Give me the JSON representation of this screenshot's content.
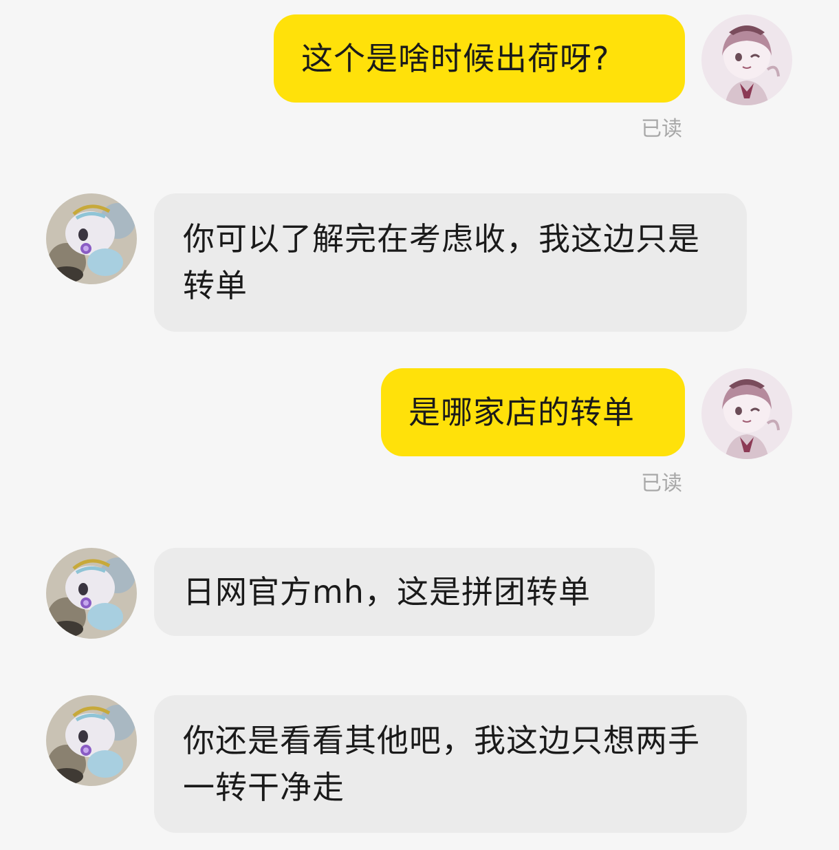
{
  "chat": {
    "messages": [
      {
        "side": "out",
        "text": "这个是啥时候出荷呀?",
        "status": "已读",
        "avatar": "self-avatar"
      },
      {
        "side": "in",
        "text": "你可以了解完在考虑收，我这边只是转单",
        "avatar": "seller-avatar"
      },
      {
        "side": "out",
        "text": "是哪家店的转单",
        "status": "已读",
        "avatar": "self-avatar"
      },
      {
        "side": "in",
        "text": "日网官方mh，这是拼团转单",
        "avatar": "seller-avatar"
      },
      {
        "side": "in",
        "text": "你还是看看其他吧，我这边只想两手一转干净走",
        "avatar": "seller-avatar"
      }
    ]
  },
  "colors": {
    "outgoing_bubble": "#ffe10a",
    "incoming_bubble": "#ebebeb",
    "background": "#f6f6f6",
    "read_status": "#a8a8a8"
  }
}
